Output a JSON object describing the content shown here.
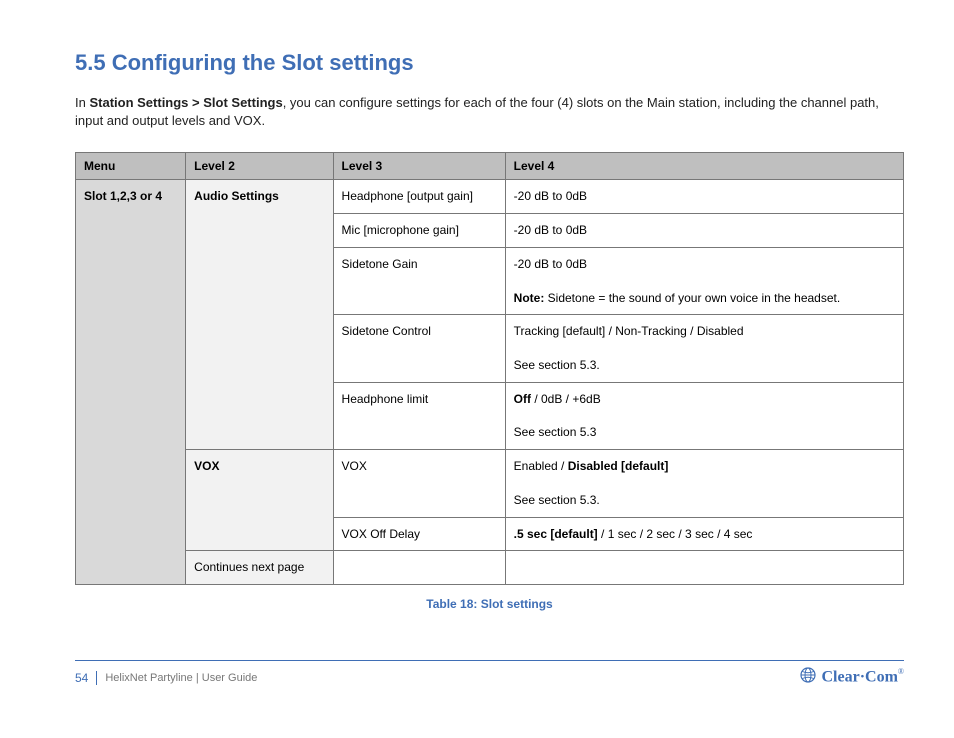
{
  "section": {
    "number": "5.5",
    "title": "Configuring the Slot settings",
    "intro_lead": "Station Settings > Slot Settings",
    "intro_rest": ", you can configure settings for each of the four (4) slots on the Main station, including the channel path, input and output levels and VOX."
  },
  "table": {
    "headers": [
      "Menu",
      "Level 2",
      "Level 3",
      "Level 4"
    ],
    "rows": [
      {
        "level1": "Slot 1,2,3 or 4",
        "level1_rowspan": 8,
        "level2": "Audio Settings",
        "level2_rowspan": 5,
        "level3": "Headphone [output gain]",
        "level4": "-20 dB to 0dB"
      },
      {
        "level3": "Mic [microphone gain]",
        "level4": "-20 dB to 0dB"
      },
      {
        "level3": "Sidetone Gain",
        "level4_html": "-20 dB to 0dB<br><br><span class=\"bold\">Note:</span> Sidetone = the sound of your own voice in the headset."
      },
      {
        "level3": "Sidetone Control",
        "level4_html": "Tracking [default] / Non-Tracking / Disabled<br><br>See section 5.3."
      },
      {
        "level3": "Headphone limit",
        "level4_html": "<span class=\"bold\">Off</span> / 0dB / +6dB<br><br>See section 5.3"
      },
      {
        "level2": "VOX",
        "level2_rowspan": 3,
        "level3": "VOX",
        "level4_html": "Enabled / <span class=\"bold\">Disabled [default]</span><br><br>See section 5.3."
      },
      {
        "level3": "VOX Off Delay",
        "level4_html": "<span class=\"bold\">.5 sec [default]</span> / 1 sec / 2 sec / 3 sec / 4 sec"
      },
      {
        "level2_info": "Continues next page",
        "level3": "",
        "level4": ""
      }
    ]
  },
  "caption": "Table 18: Slot settings",
  "footer": {
    "page": "54",
    "text": "HelixNet Partyline | User Guide",
    "brand": "Clear·Com"
  }
}
